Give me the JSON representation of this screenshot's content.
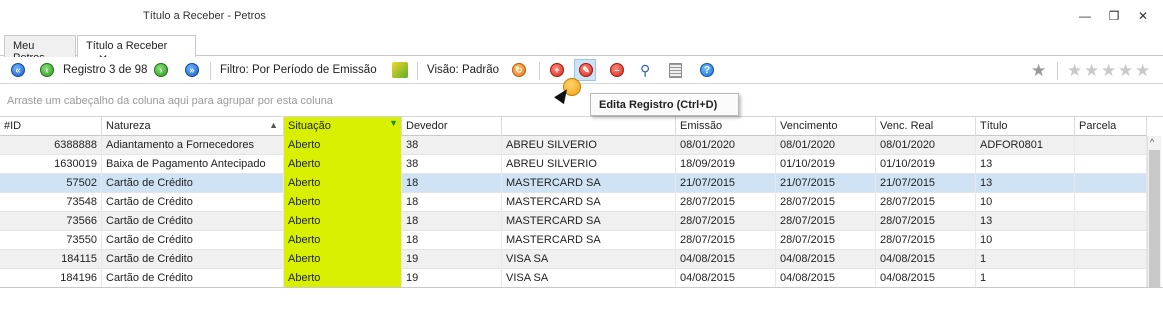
{
  "window": {
    "title": "Título a Receber - Petros",
    "minimize_icon": "minimize-icon",
    "restore_icon": "restore-icon",
    "close_icon": "close-icon"
  },
  "tabs": [
    {
      "label": "Meu Petros"
    },
    {
      "label": "Título a Receber",
      "close": "✕"
    }
  ],
  "toolbar": {
    "record_label": "Registro 3 de 98",
    "filter_label": "Filtro: Por Período de Emissão",
    "view_label": "Visão: Padrão"
  },
  "group_panel": {
    "placeholder": "Arraste um cabeçalho da coluna aqui para agrupar por esta coluna"
  },
  "tooltip": {
    "text": "Edita Registro (Ctrl+D)"
  },
  "grid": {
    "columns": [
      "#ID",
      "Natureza",
      "Situação",
      "Devedor",
      "",
      "Emissão",
      "Vencimento",
      "Venc. Real",
      "Título",
      "Parcela"
    ],
    "rows": [
      [
        "6388888",
        "Adiantamento a Fornecedores",
        "Aberto",
        "38",
        "ABREU SILVERIO",
        "08/01/2020",
        "08/01/2020",
        "08/01/2020",
        "ADFOR0801",
        ""
      ],
      [
        "1630019",
        "Baixa de Pagamento Antecipado",
        "Aberto",
        "38",
        "ABREU SILVERIO",
        "18/09/2019",
        "01/10/2019",
        "01/10/2019",
        "13",
        ""
      ],
      [
        "57502",
        "Cartão de Crédito",
        "Aberto",
        "18",
        "MASTERCARD SA",
        "21/07/2015",
        "21/07/2015",
        "21/07/2015",
        "13",
        ""
      ],
      [
        "73548",
        "Cartão de Crédito",
        "Aberto",
        "18",
        "MASTERCARD SA",
        "28/07/2015",
        "28/07/2015",
        "28/07/2015",
        "10",
        ""
      ],
      [
        "73566",
        "Cartão de Crédito",
        "Aberto",
        "18",
        "MASTERCARD SA",
        "28/07/2015",
        "28/07/2015",
        "28/07/2015",
        "13",
        ""
      ],
      [
        "73550",
        "Cartão de Crédito",
        "Aberto",
        "18",
        "MASTERCARD SA",
        "28/07/2015",
        "28/07/2015",
        "28/07/2015",
        "10",
        ""
      ],
      [
        "184115",
        "Cartão de Crédito",
        "Aberto",
        "19",
        "VISA SA",
        "04/08/2015",
        "04/08/2015",
        "04/08/2015",
        "1",
        ""
      ],
      [
        "184196",
        "Cartão de Crédito",
        "Aberto",
        "19",
        "VISA SA",
        "04/08/2015",
        "04/08/2015",
        "04/08/2015",
        "1",
        ""
      ]
    ]
  },
  "colors": {
    "highlight_column": "#d8f000",
    "selected_row": "#cfe3f5"
  }
}
